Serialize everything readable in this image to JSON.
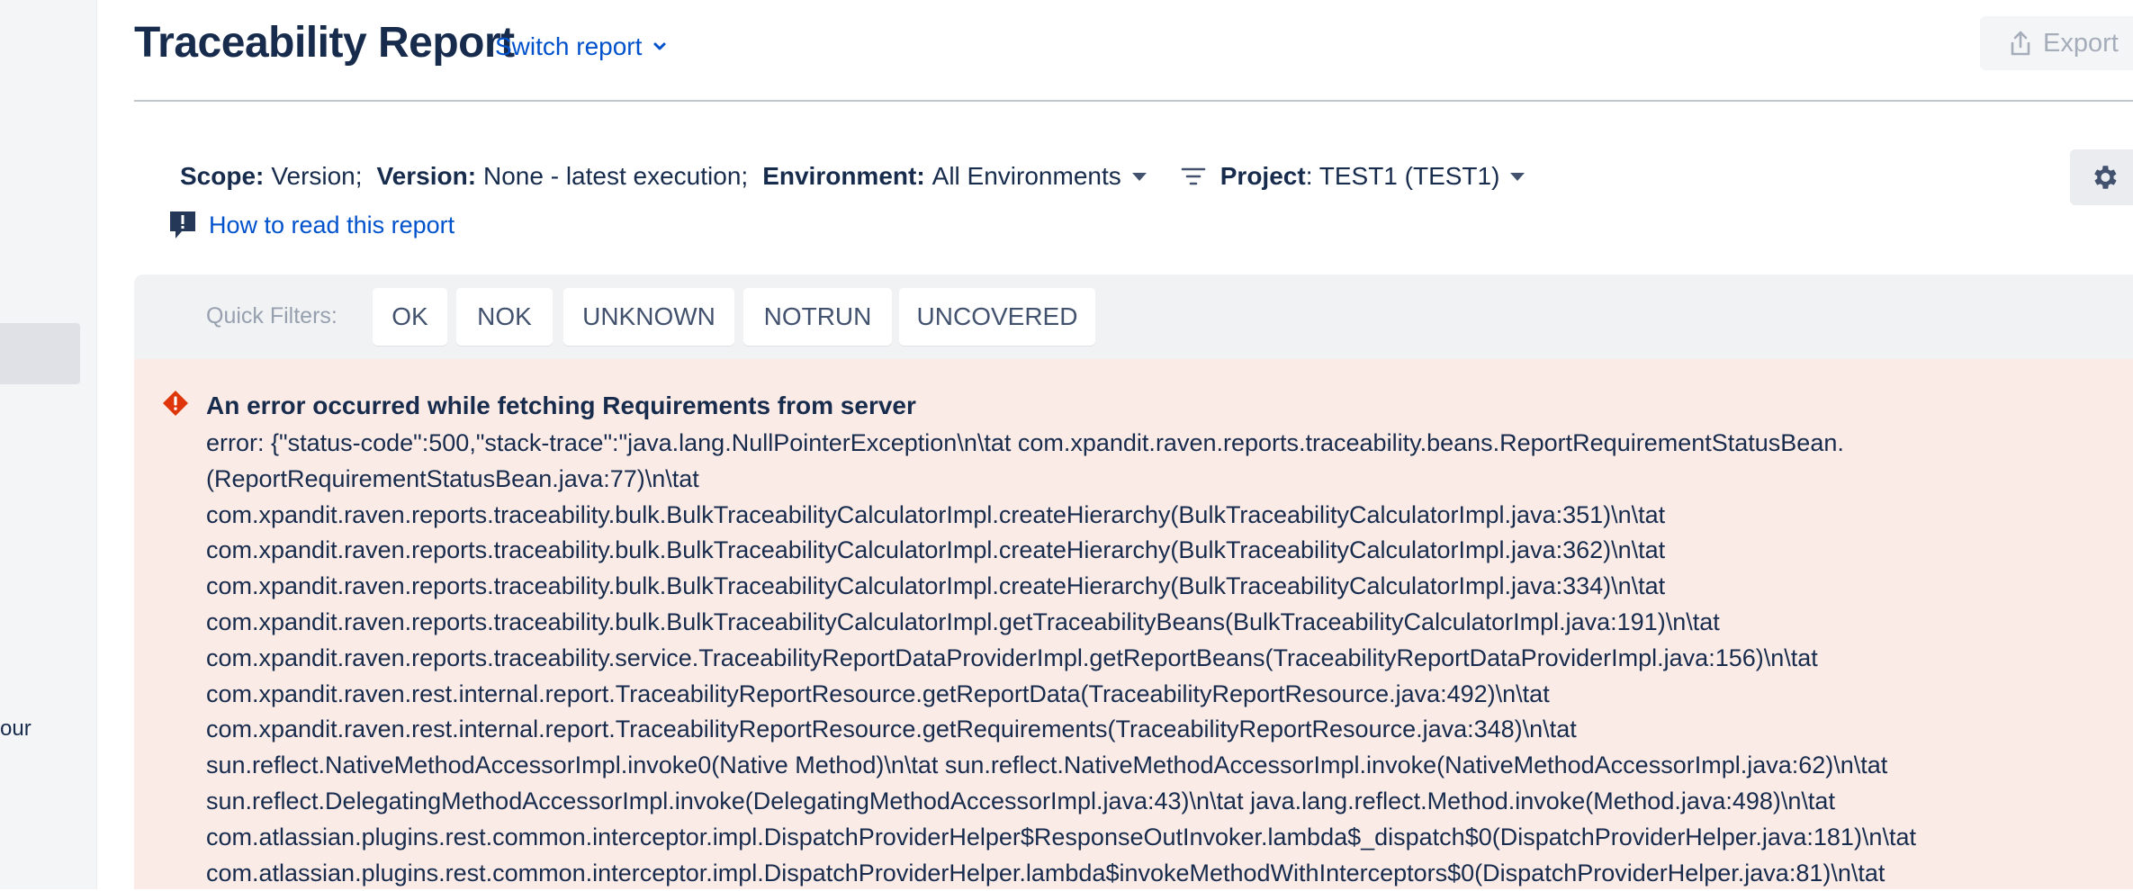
{
  "sidebar": {
    "fragment_text": "our"
  },
  "header": {
    "title": "Traceability Report",
    "switch_report_label": "Switch report",
    "export_label": "Export"
  },
  "scope": {
    "scope_label": "Scope:",
    "scope_value": "Version;",
    "version_label": "Version:",
    "version_value": "None - latest execution;",
    "environment_label": "Environment:",
    "environment_value": "All Environments",
    "project_label": "Project",
    "project_value": ": TEST1 (TEST1)"
  },
  "help": {
    "how_to_read": "How to read this report"
  },
  "quick_filters": {
    "label": "Quick Filters:",
    "buttons": [
      "OK",
      "NOK",
      "UNKNOWN",
      "NOTRUN",
      "UNCOVERED"
    ]
  },
  "error": {
    "title": "An error occurred while fetching Requirements from server",
    "lines": [
      "error: {\"status-code\":500,\"stack-trace\":\"java.lang.NullPointerException\\n\\tat com.xpandit.raven.reports.traceability.beans.ReportRequirementStatusBean.",
      "(ReportRequirementStatusBean.java:77)\\n\\tat",
      "com.xpandit.raven.reports.traceability.bulk.BulkTraceabilityCalculatorImpl.createHierarchy(BulkTraceabilityCalculatorImpl.java:351)\\n\\tat",
      "com.xpandit.raven.reports.traceability.bulk.BulkTraceabilityCalculatorImpl.createHierarchy(BulkTraceabilityCalculatorImpl.java:362)\\n\\tat",
      "com.xpandit.raven.reports.traceability.bulk.BulkTraceabilityCalculatorImpl.createHierarchy(BulkTraceabilityCalculatorImpl.java:334)\\n\\tat",
      "com.xpandit.raven.reports.traceability.bulk.BulkTraceabilityCalculatorImpl.getTraceabilityBeans(BulkTraceabilityCalculatorImpl.java:191)\\n\\tat",
      "com.xpandit.raven.reports.traceability.service.TraceabilityReportDataProviderImpl.getReportBeans(TraceabilityReportDataProviderImpl.java:156)\\n\\tat",
      "com.xpandit.raven.rest.internal.report.TraceabilityReportResource.getReportData(TraceabilityReportResource.java:492)\\n\\tat",
      "com.xpandit.raven.rest.internal.report.TraceabilityReportResource.getRequirements(TraceabilityReportResource.java:348)\\n\\tat",
      "sun.reflect.NativeMethodAccessorImpl.invoke0(Native Method)\\n\\tat sun.reflect.NativeMethodAccessorImpl.invoke(NativeMethodAccessorImpl.java:62)\\n\\tat",
      "sun.reflect.DelegatingMethodAccessorImpl.invoke(DelegatingMethodAccessorImpl.java:43)\\n\\tat java.lang.reflect.Method.invoke(Method.java:498)\\n\\tat",
      "com.atlassian.plugins.rest.common.interceptor.impl.DispatchProviderHelper$ResponseOutInvoker.lambda$_dispatch$0(DispatchProviderHelper.java:181)\\n\\tat",
      "com.atlassian.plugins.rest.common.interceptor.impl.DispatchProviderHelper.lambda$invokeMethodWithInterceptors$0(DispatchProviderHelper.java:81)\\n\\tat"
    ]
  },
  "colors": {
    "link": "#0052cc",
    "error_bg": "#fbebe7",
    "error_icon": "#de350b",
    "text": "#172b4d"
  }
}
